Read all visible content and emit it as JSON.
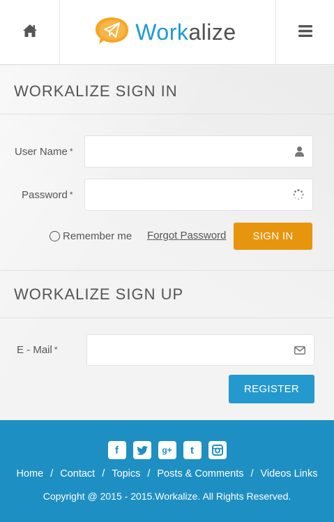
{
  "header": {
    "logo_part1": "Work",
    "logo_part2": "alize",
    "home_icon": "home-icon",
    "menu_icon": "hamburger-menu-icon"
  },
  "signin": {
    "title": "WORKALIZE SIGN IN",
    "username_label": "User Name",
    "username_value": "",
    "password_label": "Password",
    "password_value": "",
    "required_mark": "*",
    "remember_label": "Remember me",
    "forgot_label": "Forgot Password",
    "button_label": "SIGN IN"
  },
  "signup": {
    "title": "WORKALIZE SIGN UP",
    "email_label": "E - Mail",
    "email_value": "",
    "button_label": "REGISTER"
  },
  "footer": {
    "social": [
      "facebook",
      "twitter",
      "google-plus",
      "tumblr",
      "instagram"
    ],
    "nav": [
      "Home",
      "Contact",
      "Topics",
      "Posts & Comments",
      "Videos Links"
    ],
    "separator": "/",
    "copyright": "Copyright @ 2015 - 2015.Workalize. All Rights Reserved."
  },
  "colors": {
    "brand_blue": "#1b9ad3",
    "signin_orange": "#e8950e",
    "register_blue": "#2499ce",
    "footer_bg": "#1e8fc2",
    "logo_orange": "#f5a623"
  }
}
